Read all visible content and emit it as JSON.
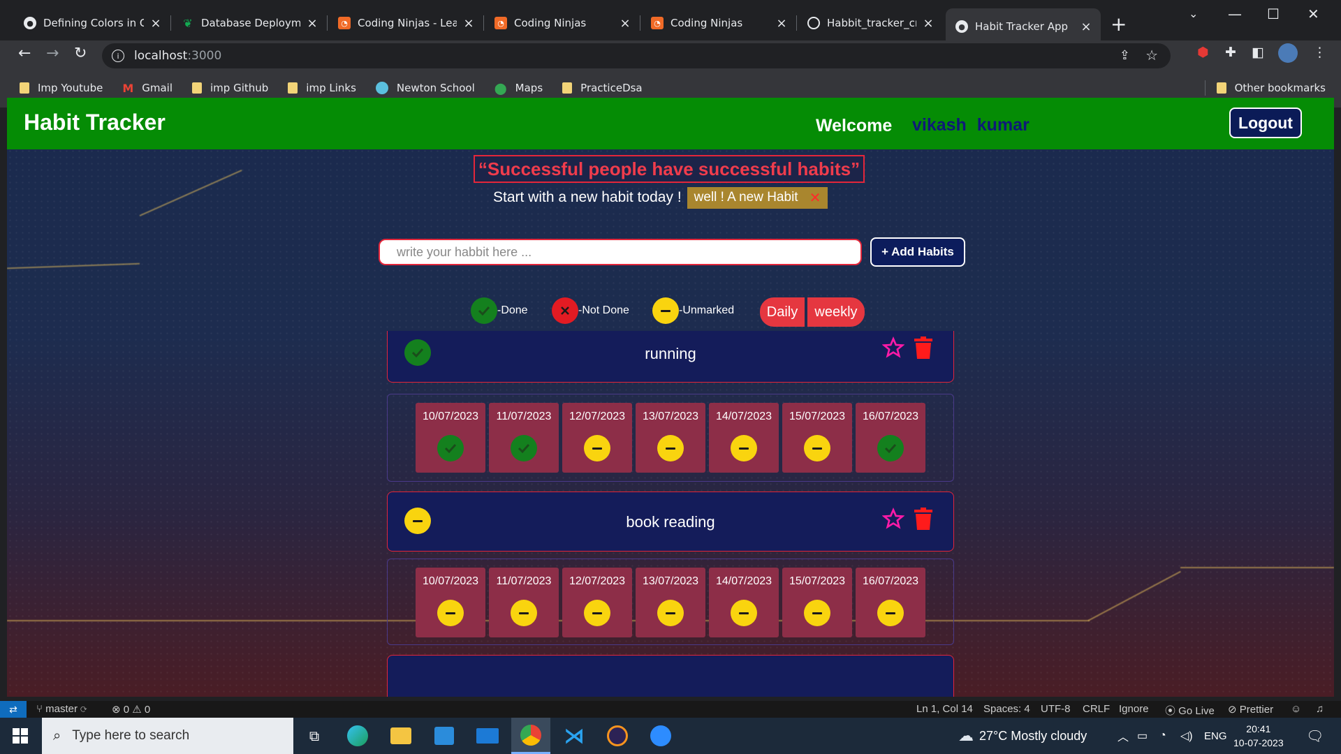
{
  "browser": {
    "tabs": [
      {
        "title": "Defining Colors in CS",
        "favicon": "globe-icon"
      },
      {
        "title": "Database Deploymen",
        "favicon": "mongodb-leaf-icon"
      },
      {
        "title": "Coding Ninjas - Learn",
        "favicon": "coding-ninjas-icon"
      },
      {
        "title": "Coding Ninjas",
        "favicon": "coding-ninjas-icon"
      },
      {
        "title": "Coding Ninjas",
        "favicon": "coding-ninjas-icon"
      },
      {
        "title": "Habbit_tracker_cn/as",
        "favicon": "github-icon"
      },
      {
        "title": "Habit Tracker App",
        "favicon": "globe-icon",
        "active": true
      }
    ],
    "url_host": "localhost",
    "url_port": ":3000",
    "bookmarks": [
      {
        "label": "Imp Youtube",
        "icon": "folder-icon"
      },
      {
        "label": "Gmail",
        "icon": "gmail-icon"
      },
      {
        "label": "imp Github",
        "icon": "folder-icon"
      },
      {
        "label": "imp Links",
        "icon": "folder-icon"
      },
      {
        "label": "Newton School",
        "icon": "newton-school-icon"
      },
      {
        "label": "Maps",
        "icon": "maps-pin-icon"
      },
      {
        "label": "PracticeDsa",
        "icon": "folder-icon"
      }
    ],
    "other_bookmarks": "Other bookmarks"
  },
  "app": {
    "brand": "Habit Tracker",
    "welcome": "Welcome",
    "username": "vikash kumar",
    "logout": "Logout",
    "quote": "“Successful people have successful habits”",
    "start_text": "Start with a new habit today !",
    "notice": "well ! A new Habit",
    "notice_close": "✕",
    "input_placeholder": "write your habbit here ...",
    "add_button": "+ Add Habits",
    "legend": {
      "done": "-Done",
      "not_done": "-Not Done",
      "unmarked": "-Unmarked"
    },
    "views": {
      "daily": "Daily",
      "weekly": "weekly"
    },
    "colors": {
      "navbar": "#058c05",
      "done": "#14801e",
      "not_done": "#e31b23",
      "unmarked": "#f9d40f",
      "accent": "#e3263a",
      "card": "#141c5a",
      "day_cell": "#8d2e48"
    },
    "habits": [
      {
        "name": "running",
        "status": "done",
        "days": [
          {
            "date": "10/07/2023",
            "status": "done"
          },
          {
            "date": "11/07/2023",
            "status": "done"
          },
          {
            "date": "12/07/2023",
            "status": "unmarked"
          },
          {
            "date": "13/07/2023",
            "status": "unmarked"
          },
          {
            "date": "14/07/2023",
            "status": "unmarked"
          },
          {
            "date": "15/07/2023",
            "status": "unmarked"
          },
          {
            "date": "16/07/2023",
            "status": "done"
          }
        ]
      },
      {
        "name": "book reading",
        "status": "unmarked",
        "days": [
          {
            "date": "10/07/2023",
            "status": "unmarked"
          },
          {
            "date": "11/07/2023",
            "status": "unmarked"
          },
          {
            "date": "12/07/2023",
            "status": "unmarked"
          },
          {
            "date": "13/07/2023",
            "status": "unmarked"
          },
          {
            "date": "14/07/2023",
            "status": "unmarked"
          },
          {
            "date": "15/07/2023",
            "status": "unmarked"
          },
          {
            "date": "16/07/2023",
            "status": "unmarked"
          }
        ]
      }
    ]
  },
  "vscode_status": {
    "branch": "master",
    "errors": "0",
    "warnings": "0",
    "position": "Ln 1, Col 14",
    "spaces": "Spaces: 4",
    "encoding": "UTF-8",
    "eol": "CRLF",
    "ignore": "Ignore",
    "golive": "Go Live",
    "prettier": "Prettier"
  },
  "taskbar": {
    "search_placeholder": "Type here to search",
    "weather": "27°C  Mostly cloudy",
    "language": "ENG",
    "time": "20:41",
    "date": "10-07-2023"
  }
}
